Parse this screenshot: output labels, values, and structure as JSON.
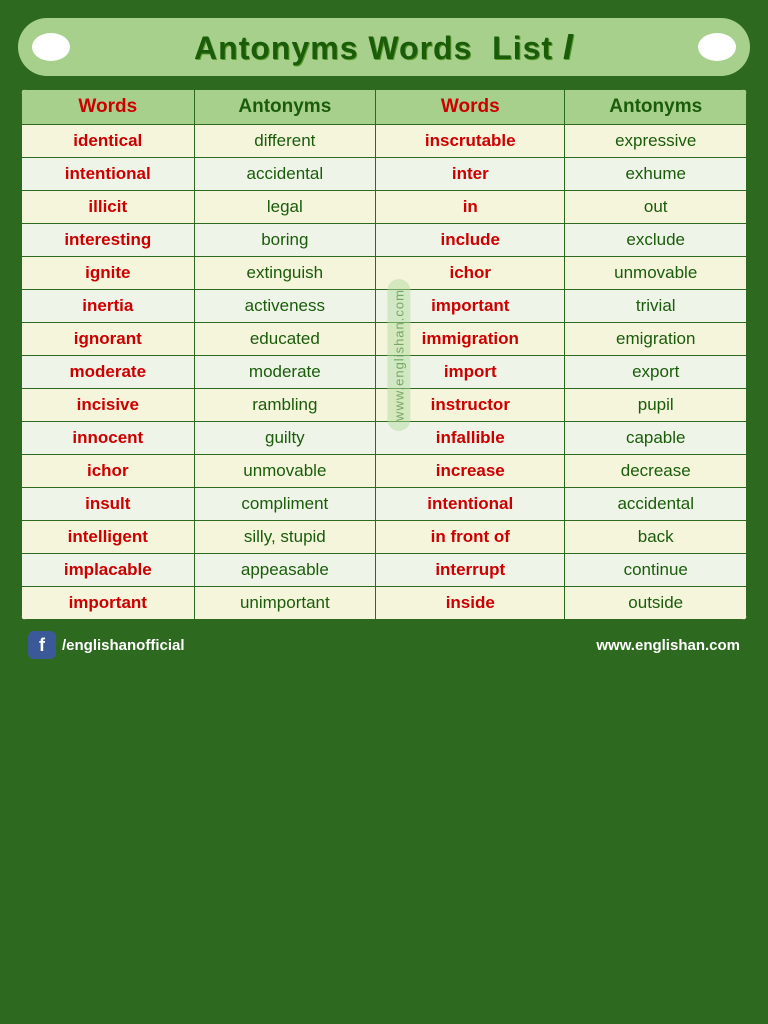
{
  "title": {
    "main": "Antonyms Words  List",
    "roman": "I"
  },
  "table": {
    "columns": [
      "Words",
      "Antonyms",
      "Words",
      "Antonyms"
    ],
    "rows": [
      {
        "w1": "identical",
        "a1": "different",
        "w2": "inscrutable",
        "a2": "expressive"
      },
      {
        "w1": "intentional",
        "a1": "accidental",
        "w2": "inter",
        "a2": "exhume"
      },
      {
        "w1": "illicit",
        "a1": "legal",
        "w2": "in",
        "a2": "out"
      },
      {
        "w1": "interesting",
        "a1": "boring",
        "w2": "include",
        "a2": "exclude"
      },
      {
        "w1": "ignite",
        "a1": "extinguish",
        "w2": "ichor",
        "a2": "unmovable"
      },
      {
        "w1": "inertia",
        "a1": "activeness",
        "w2": "important",
        "a2": "trivial"
      },
      {
        "w1": "ignorant",
        "a1": "educated",
        "w2": "immigration",
        "a2": "emigration"
      },
      {
        "w1": "moderate",
        "a1": "moderate",
        "w2": "import",
        "a2": "export"
      },
      {
        "w1": "incisive",
        "a1": "rambling",
        "w2": "instructor",
        "a2": "pupil"
      },
      {
        "w1": "innocent",
        "a1": "guilty",
        "w2": "infallible",
        "a2": "capable"
      },
      {
        "w1": "ichor",
        "a1": "unmovable",
        "w2": "increase",
        "a2": "decrease"
      },
      {
        "w1": "insult",
        "a1": "compliment",
        "w2": "intentional",
        "a2": "accidental"
      },
      {
        "w1": "intelligent",
        "a1": "silly, stupid",
        "w2": "in front of",
        "a2": "back"
      },
      {
        "w1": "implacable",
        "a1": "appeasable",
        "w2": "interrupt",
        "a2": "continue"
      },
      {
        "w1": "important",
        "a1": "unimportant",
        "w2": "inside",
        "a2": "outside"
      }
    ]
  },
  "watermark": "www.englishan.com",
  "footer": {
    "fb_handle": "/englishanofficial",
    "website": "www.englishan.com"
  }
}
